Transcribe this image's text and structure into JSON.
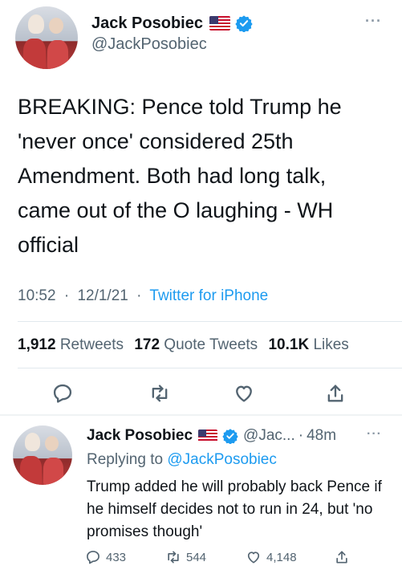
{
  "main_tweet": {
    "display_name": "Jack Posobiec",
    "handle": "@JackPosobiec",
    "text": "BREAKING: Pence told Trump he 'never once' considered 25th Amendment. Both had long talk, came out of the O laughing - WH official",
    "time": "10:52",
    "date": "12/1/21",
    "source": "Twitter for iPhone",
    "separator": "·",
    "retweets_count": "1,912",
    "retweets_label": "Retweets",
    "quotes_count": "172",
    "quotes_label": "Quote Tweets",
    "likes_count": "10.1K",
    "likes_label": "Likes"
  },
  "reply_tweet": {
    "display_name": "Jack Posobiec",
    "handle": "@Jac...",
    "separator": "·",
    "age": "48m",
    "replying_prefix": "Replying to",
    "replying_handle": "@JackPosobiec",
    "text": "Trump added he will probably back Pence if he himself decides not to run in 24, but 'no promises though'",
    "reply_count": "433",
    "retweet_count": "544",
    "like_count": "4,148"
  },
  "icons": {
    "verified": "verified-badge-icon",
    "flag": "us-flag-icon",
    "more": "more-icon",
    "reply": "reply-icon",
    "retweet": "retweet-icon",
    "like": "heart-icon",
    "share": "share-icon"
  },
  "colors": {
    "accent": "#1d9bf0",
    "text": "#0f1419",
    "secondary": "#536471",
    "divider": "#e1e8ed"
  }
}
